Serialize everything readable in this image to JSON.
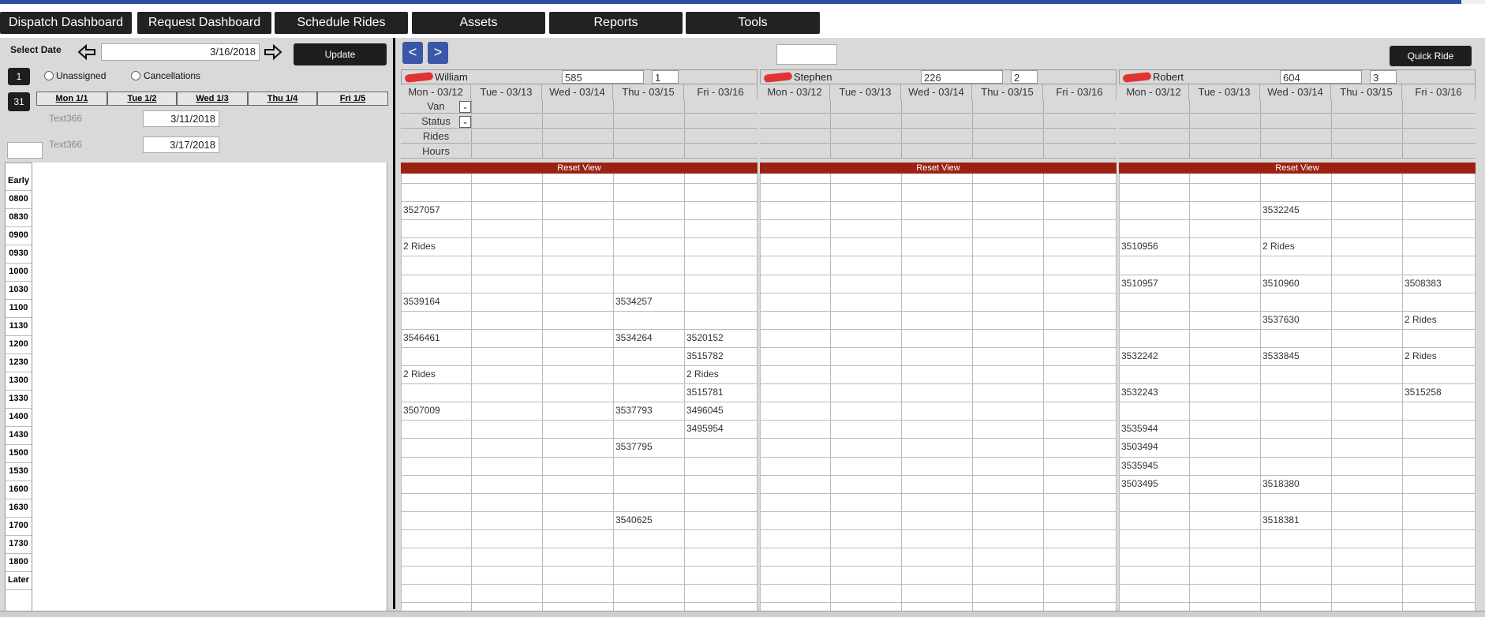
{
  "nav": [
    "Dispatch Dashboard",
    "Request Dashboard",
    "Schedule Rides",
    "Assets",
    "Reports",
    "Tools"
  ],
  "left": {
    "select_date_label": "Select Date",
    "date_value": "3/16/2018",
    "update": "Update",
    "btn1": "1",
    "btn31": "31",
    "unassigned": "Unassigned",
    "cancellations": "Cancellations",
    "week_days": [
      "Mon 1/1",
      "Tue 1/2",
      "Wed 1/3",
      "Thu 1/4",
      "Fri 1/5"
    ],
    "text366_a": "Text366",
    "date_a": "3/11/2018",
    "text366_b": "Text366",
    "date_b": "3/17/2018"
  },
  "times": [
    "Early",
    "0800",
    "0830",
    "0900",
    "0930",
    "1000",
    "1030",
    "1100",
    "1130",
    "1200",
    "1230",
    "1300",
    "1330",
    "1400",
    "1430",
    "1500",
    "1530",
    "1600",
    "1630",
    "1700",
    "1730",
    "1800",
    "Later"
  ],
  "prev": "<",
  "next": ">",
  "quick_ride": "Quick Ride",
  "day_headers": [
    "Mon - 03/12",
    "Tue - 03/13",
    "Wed - 03/14",
    "Thu - 03/15",
    "Fri - 03/16"
  ],
  "meta_labels": [
    "Van",
    "Status",
    "Rides",
    "Hours"
  ],
  "reset_view": "Reset View",
  "drivers": [
    {
      "name": "William",
      "id": "585",
      "num": "1",
      "cells": [
        {
          "row": 1,
          "col": 0,
          "text": "3527057"
        },
        {
          "row": 3,
          "col": 0,
          "text": "2 Rides"
        },
        {
          "row": 6,
          "col": 0,
          "text": "3539164"
        },
        {
          "row": 6,
          "col": 3,
          "text": "3534257"
        },
        {
          "row": 8,
          "col": 0,
          "text": "3546461"
        },
        {
          "row": 8,
          "col": 3,
          "text": "3534264"
        },
        {
          "row": 8,
          "col": 4,
          "text": "3520152"
        },
        {
          "row": 9,
          "col": 4,
          "text": "3515782"
        },
        {
          "row": 10,
          "col": 0,
          "text": "2 Rides"
        },
        {
          "row": 10,
          "col": 4,
          "text": "2 Rides"
        },
        {
          "row": 11,
          "col": 4,
          "text": "3515781"
        },
        {
          "row": 12,
          "col": 0,
          "text": "3507009"
        },
        {
          "row": 12,
          "col": 3,
          "text": "3537793"
        },
        {
          "row": 12,
          "col": 4,
          "text": "3496045"
        },
        {
          "row": 13,
          "col": 4,
          "text": "3495954"
        },
        {
          "row": 14,
          "col": 3,
          "text": "3537795"
        },
        {
          "row": 18,
          "col": 3,
          "text": "3540625"
        }
      ]
    },
    {
      "name": "Stephen",
      "id": "226",
      "num": "2",
      "cells": []
    },
    {
      "name": "Robert",
      "id": "604",
      "num": "3",
      "cells": [
        {
          "row": 1,
          "col": 2,
          "text": "3532245"
        },
        {
          "row": 3,
          "col": 0,
          "text": "3510956"
        },
        {
          "row": 3,
          "col": 2,
          "text": "2 Rides"
        },
        {
          "row": 5,
          "col": 0,
          "text": "3510957"
        },
        {
          "row": 5,
          "col": 2,
          "text": "3510960"
        },
        {
          "row": 5,
          "col": 4,
          "text": "3508383"
        },
        {
          "row": 7,
          "col": 2,
          "text": "3537630"
        },
        {
          "row": 7,
          "col": 4,
          "text": "2 Rides"
        },
        {
          "row": 9,
          "col": 0,
          "text": "3532242"
        },
        {
          "row": 9,
          "col": 2,
          "text": "3533845"
        },
        {
          "row": 9,
          "col": 4,
          "text": "2 Rides"
        },
        {
          "row": 11,
          "col": 0,
          "text": "3532243"
        },
        {
          "row": 11,
          "col": 4,
          "text": "3515258"
        },
        {
          "row": 13,
          "col": 0,
          "text": "3535944"
        },
        {
          "row": 14,
          "col": 0,
          "text": "3503494"
        },
        {
          "row": 15,
          "col": 0,
          "text": "3535945"
        },
        {
          "row": 16,
          "col": 0,
          "text": "3503495"
        },
        {
          "row": 16,
          "col": 2,
          "text": "3518380"
        },
        {
          "row": 18,
          "col": 2,
          "text": "3518381"
        }
      ]
    }
  ]
}
